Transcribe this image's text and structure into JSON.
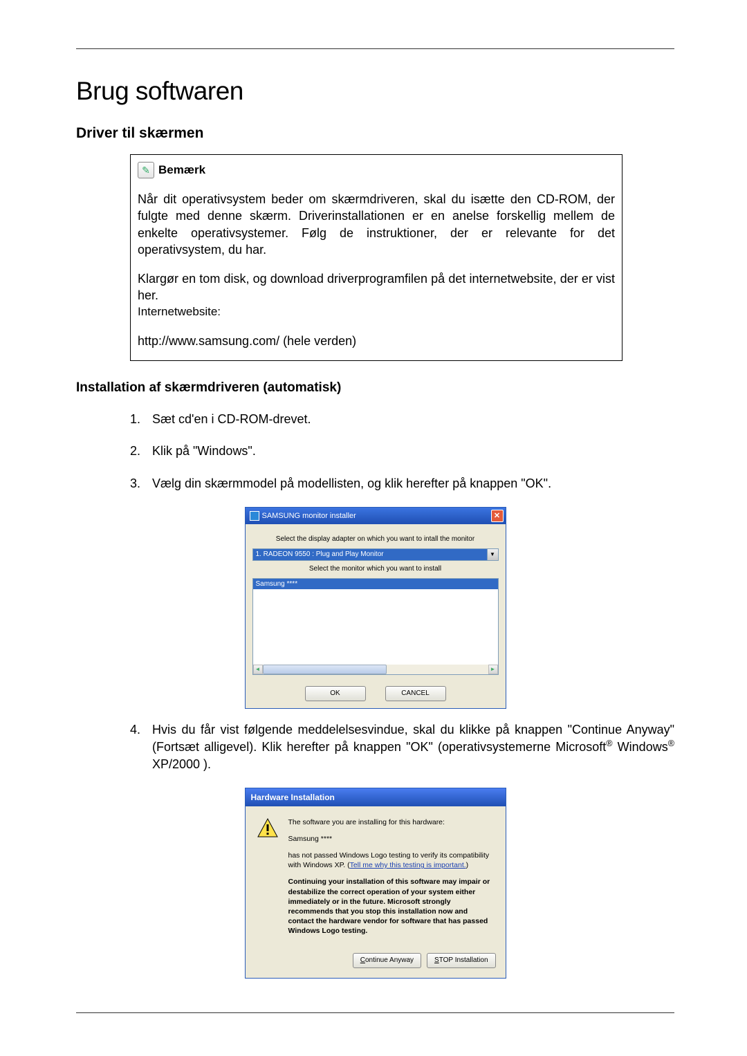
{
  "title": "Brug softwaren",
  "section1_title": "Driver til skærmen",
  "note": {
    "label": "Bemærk",
    "p1": "Når dit operativsystem beder om skærmdriveren, skal du isætte den CD-ROM, der fulgte med denne skærm. Driverinstallationen er en anelse forskellig mellem de enkelte operativsystemer. Følg de instruktioner, der er relevante for det operativsystem, du har.",
    "p2": "Klargør en tom disk, og download driverprogramfilen på det internetwebsite, der er vist her.",
    "label2": "Internetwebsite:",
    "url": "http://www.samsung.com/ (hele verden)"
  },
  "section2_title": "Installation af skærmdriveren (automatisk)",
  "steps": {
    "s1_num": "1.",
    "s1": "Sæt cd'en i CD-ROM-drevet.",
    "s2_num": "2.",
    "s2": "Klik på \"Windows\".",
    "s3_num": "3.",
    "s3": "Vælg din skærmmodel på modellisten, og klik herefter på knappen \"OK\".",
    "s4_num": "4.",
    "s4_a": "Hvis du får vist følgende meddelelsesvindue, skal du klikke på knappen \"Continue Anyway\" (Fortsæt alligevel). Klik herefter på knappen \"OK\" (operativsystemerne Microsoft",
    "s4_b": " Windows",
    "s4_c": " XP/2000 )."
  },
  "installer": {
    "title": "SAMSUNG monitor installer",
    "label1": "Select the display adapter on which you want to intall the monitor",
    "adapter": "1. RADEON 9550 : Plug and Play Monitor",
    "label2": "Select the monitor which you want to install",
    "monitor": "Samsung ****",
    "ok": "OK",
    "cancel": "CANCEL"
  },
  "hw": {
    "title": "Hardware Installation",
    "l1": "The software you are installing for this hardware:",
    "name": "Samsung ****",
    "l2a": "has not passed Windows Logo testing to verify its compatibility with Windows XP. (",
    "l2link": "Tell me why this testing is important.",
    "l2b": ")",
    "warn": "Continuing your installation of this software may impair or destabilize the correct operation of your system either immediately or in the future. Microsoft strongly recommends that you stop this installation now and contact the hardware vendor for software that has passed Windows Logo testing.",
    "continue": "Continue Anyway",
    "stop": "STOP Installation"
  }
}
